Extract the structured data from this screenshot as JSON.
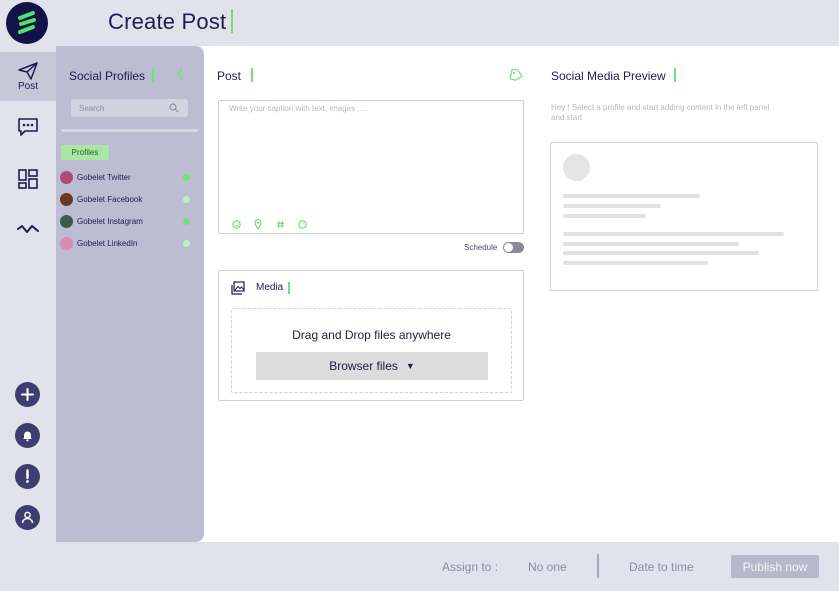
{
  "header": {
    "title": "Create Post"
  },
  "rail": {
    "items": [
      {
        "icon": "paper-plane-icon",
        "label": "Post",
        "active": true
      },
      {
        "icon": "chat-icon",
        "label": ""
      },
      {
        "icon": "dashboard-icon",
        "label": ""
      },
      {
        "icon": "analytics-icon",
        "label": ""
      }
    ],
    "bottom": [
      "add-icon",
      "bell-icon",
      "alert-icon",
      "user-icon"
    ]
  },
  "profiles": {
    "title": "Social Profiles",
    "search_placeholder": "Search",
    "tag": "Profiles",
    "items": [
      {
        "name": "Gobelet Twitter",
        "status_color": "#6fe36f"
      },
      {
        "name": "Gobelet Facebook",
        "status_color": "#c3ecc0"
      },
      {
        "name": "Gobelet Instagram",
        "status_color": "#6fe36f"
      },
      {
        "name": "Gobelet LinkedIn",
        "status_color": "#c3ecc0"
      }
    ]
  },
  "post": {
    "title": "Post",
    "caption_placeholder": "Write your caption with text, images , ...",
    "tools": [
      "emoji-icon",
      "location-icon",
      "hashtag-icon",
      "smiley-icon"
    ],
    "schedule_label": "Schedule",
    "schedule_on": false
  },
  "media": {
    "title": "Media",
    "drop_text": "Drag and Drop files anywhere",
    "browse_label": "Browser files",
    "browse_arrow": "▼"
  },
  "preview": {
    "title": "Social Media Preview",
    "hint": "Hey !  Select a profile and start adding content in the left panel and start"
  },
  "footer": {
    "assign_label": "Assign to :",
    "assign_value": "No one",
    "date_value": "Date to time",
    "publish_label": "Publish now"
  },
  "colors": {
    "accent": "#6fe36f",
    "navy": "#1d1d52",
    "panel": "#bcbcd3",
    "chrome": "#e2e2ec"
  }
}
